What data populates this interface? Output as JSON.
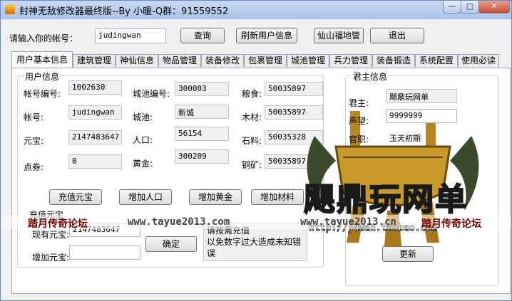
{
  "window": {
    "title": "封神无敌修改器最终版--By 小暖-Q群：91559552",
    "min": "—",
    "max": "□",
    "close": "✕"
  },
  "account_bar": {
    "prompt": "请输入你的帐号：",
    "account_value": "judingwan",
    "query_label": "查询",
    "refresh_label": "刷新用户信息",
    "fairy_label": "仙山福地管",
    "exit_label": "退出"
  },
  "tabs": [
    "用户基本信息",
    "建筑管理",
    "神仙信息",
    "物品管理",
    "装备修改",
    "包裹管理",
    "城池管理",
    "兵力管理",
    "装备锻造",
    "系统配置",
    "使用必读"
  ],
  "user_info": {
    "legend": "用户信息",
    "account_no_label": "帐号编号:",
    "account_no": "1002630",
    "account_label": "帐号:",
    "account": "judingwan",
    "yuanbao_label": "元宝:",
    "yuanbao": "2147483647",
    "coupon_label": "点券:",
    "coupon": "0",
    "city_no_label": "城池编号:",
    "city_no": "300003",
    "city_label": "城池:",
    "city": "新城",
    "population_label": "人口:",
    "population": "56154",
    "gold_label": "黄金:",
    "gold": "300209",
    "food_label": "粮食:",
    "food": "50035897",
    "wood_label": "木材:",
    "wood": "50035897",
    "stone_label": "石料:",
    "stone": "50035328",
    "copper_label": "铜矿:",
    "copper": "50035897"
  },
  "actions": {
    "recharge": "充值元宝",
    "add_population": "增加人口",
    "add_gold": "增加黄金",
    "add_material": "增加材料"
  },
  "recharge": {
    "legend": "充值元宝",
    "current_label": "现有元宝:",
    "current_value": "2147483647",
    "add_label": "增加元宝:",
    "add_value": "",
    "confirm_label": "确定",
    "note_lines": [
      "请按需充值",
      "以免数字过大造成未知错误"
    ]
  },
  "lord_info": {
    "legend": "君主信息",
    "lord_label": "君主:",
    "lord_value": "飓鼎玩网单",
    "prestige_label": "声望:",
    "prestige_value": "9999999",
    "official_label": "官职:",
    "official_value": "玉天初期",
    "apply_label": "更新"
  },
  "watermark": {
    "left_text": "踏月传奇论坛",
    "left_url": "www.tayue2013.com",
    "right_url": "www.tayue2013.cn",
    "right_text": "踏月传奇论坛",
    "logo_text": "飓鼎玩网单",
    "logo_url": "http://jdwan.taobao.com"
  },
  "colors": {
    "accent_title": "#a9c3e8",
    "watermark_red": "#7a0000",
    "logo_gold": "#c79a2a"
  },
  "icons": [
    "app-icon",
    "minimize-icon",
    "maximize-icon",
    "close-icon",
    "tripod-logo-icon"
  ]
}
